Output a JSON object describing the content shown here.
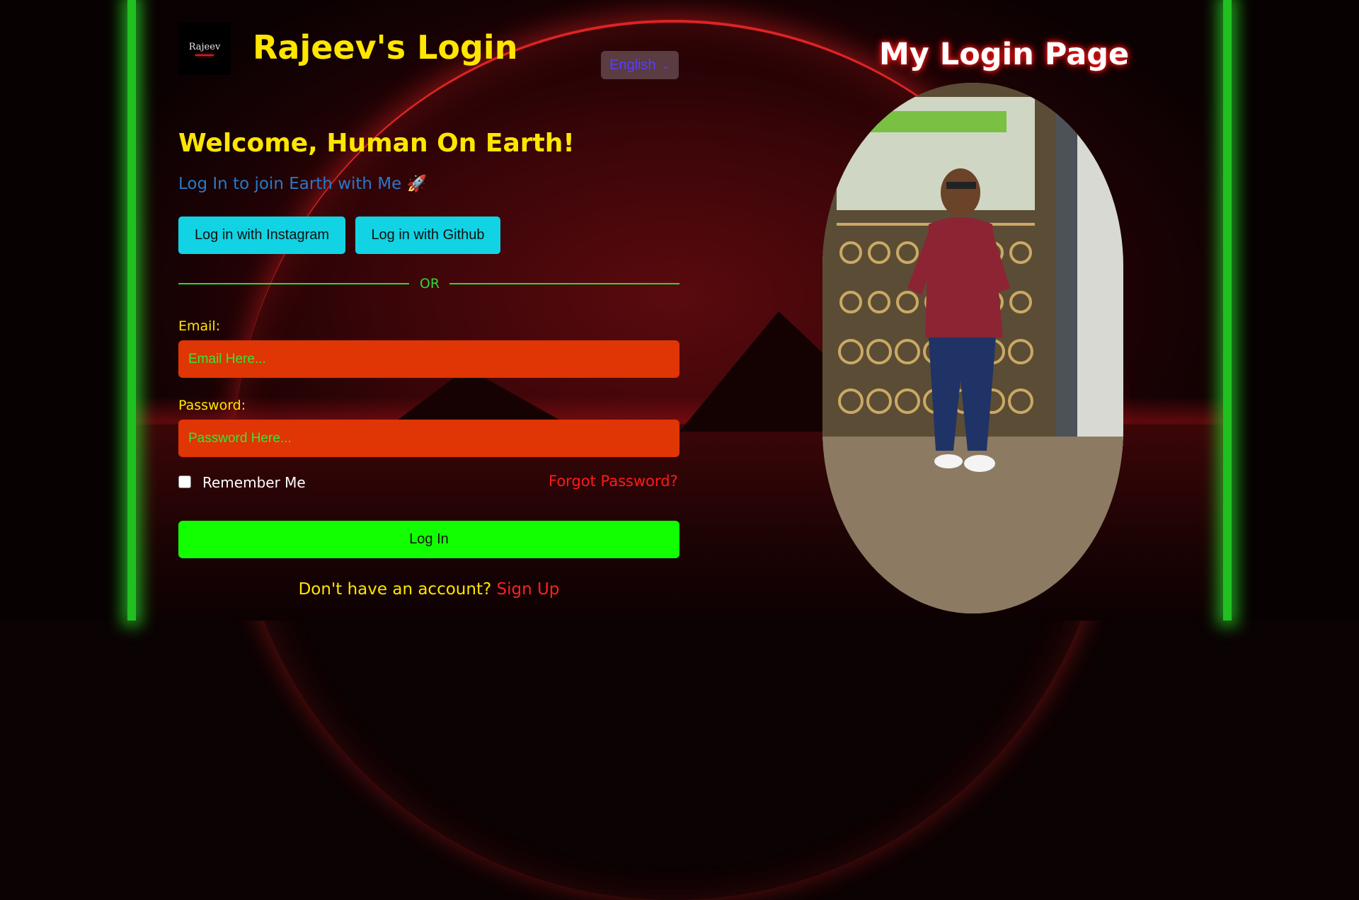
{
  "brand": {
    "logo_text": "Rajeev",
    "title": "Rajeev's Login"
  },
  "language": {
    "selected": "English"
  },
  "hero": {
    "welcome": "Welcome, Human On Earth!",
    "subtitle": "Log In to join Earth with Me 🚀"
  },
  "social": {
    "instagram_label": "Log in with Instagram",
    "github_label": "Log in with Github"
  },
  "divider": {
    "text": "OR"
  },
  "form": {
    "email_label": "Email:",
    "email_placeholder": "Email Here...",
    "password_label": "Password:",
    "password_placeholder": "Password Here...",
    "remember_label": "Remember Me",
    "remember_checked": false,
    "forgot_label": "Forgot Password?",
    "login_label": "Log In"
  },
  "signup": {
    "question": "Don't have an account?",
    "link": "Sign Up"
  },
  "right": {
    "page_title": "My Login Page"
  },
  "colors": {
    "accent_yellow": "#ffe600",
    "input_bg": "#e03505",
    "social_bg": "#11d3e3",
    "login_bg": "#11ff00",
    "link_red": "#ff1a1a",
    "edge_green": "#21c021"
  },
  "icons": [
    "rocket-icon",
    "chevron-down-icon"
  ]
}
